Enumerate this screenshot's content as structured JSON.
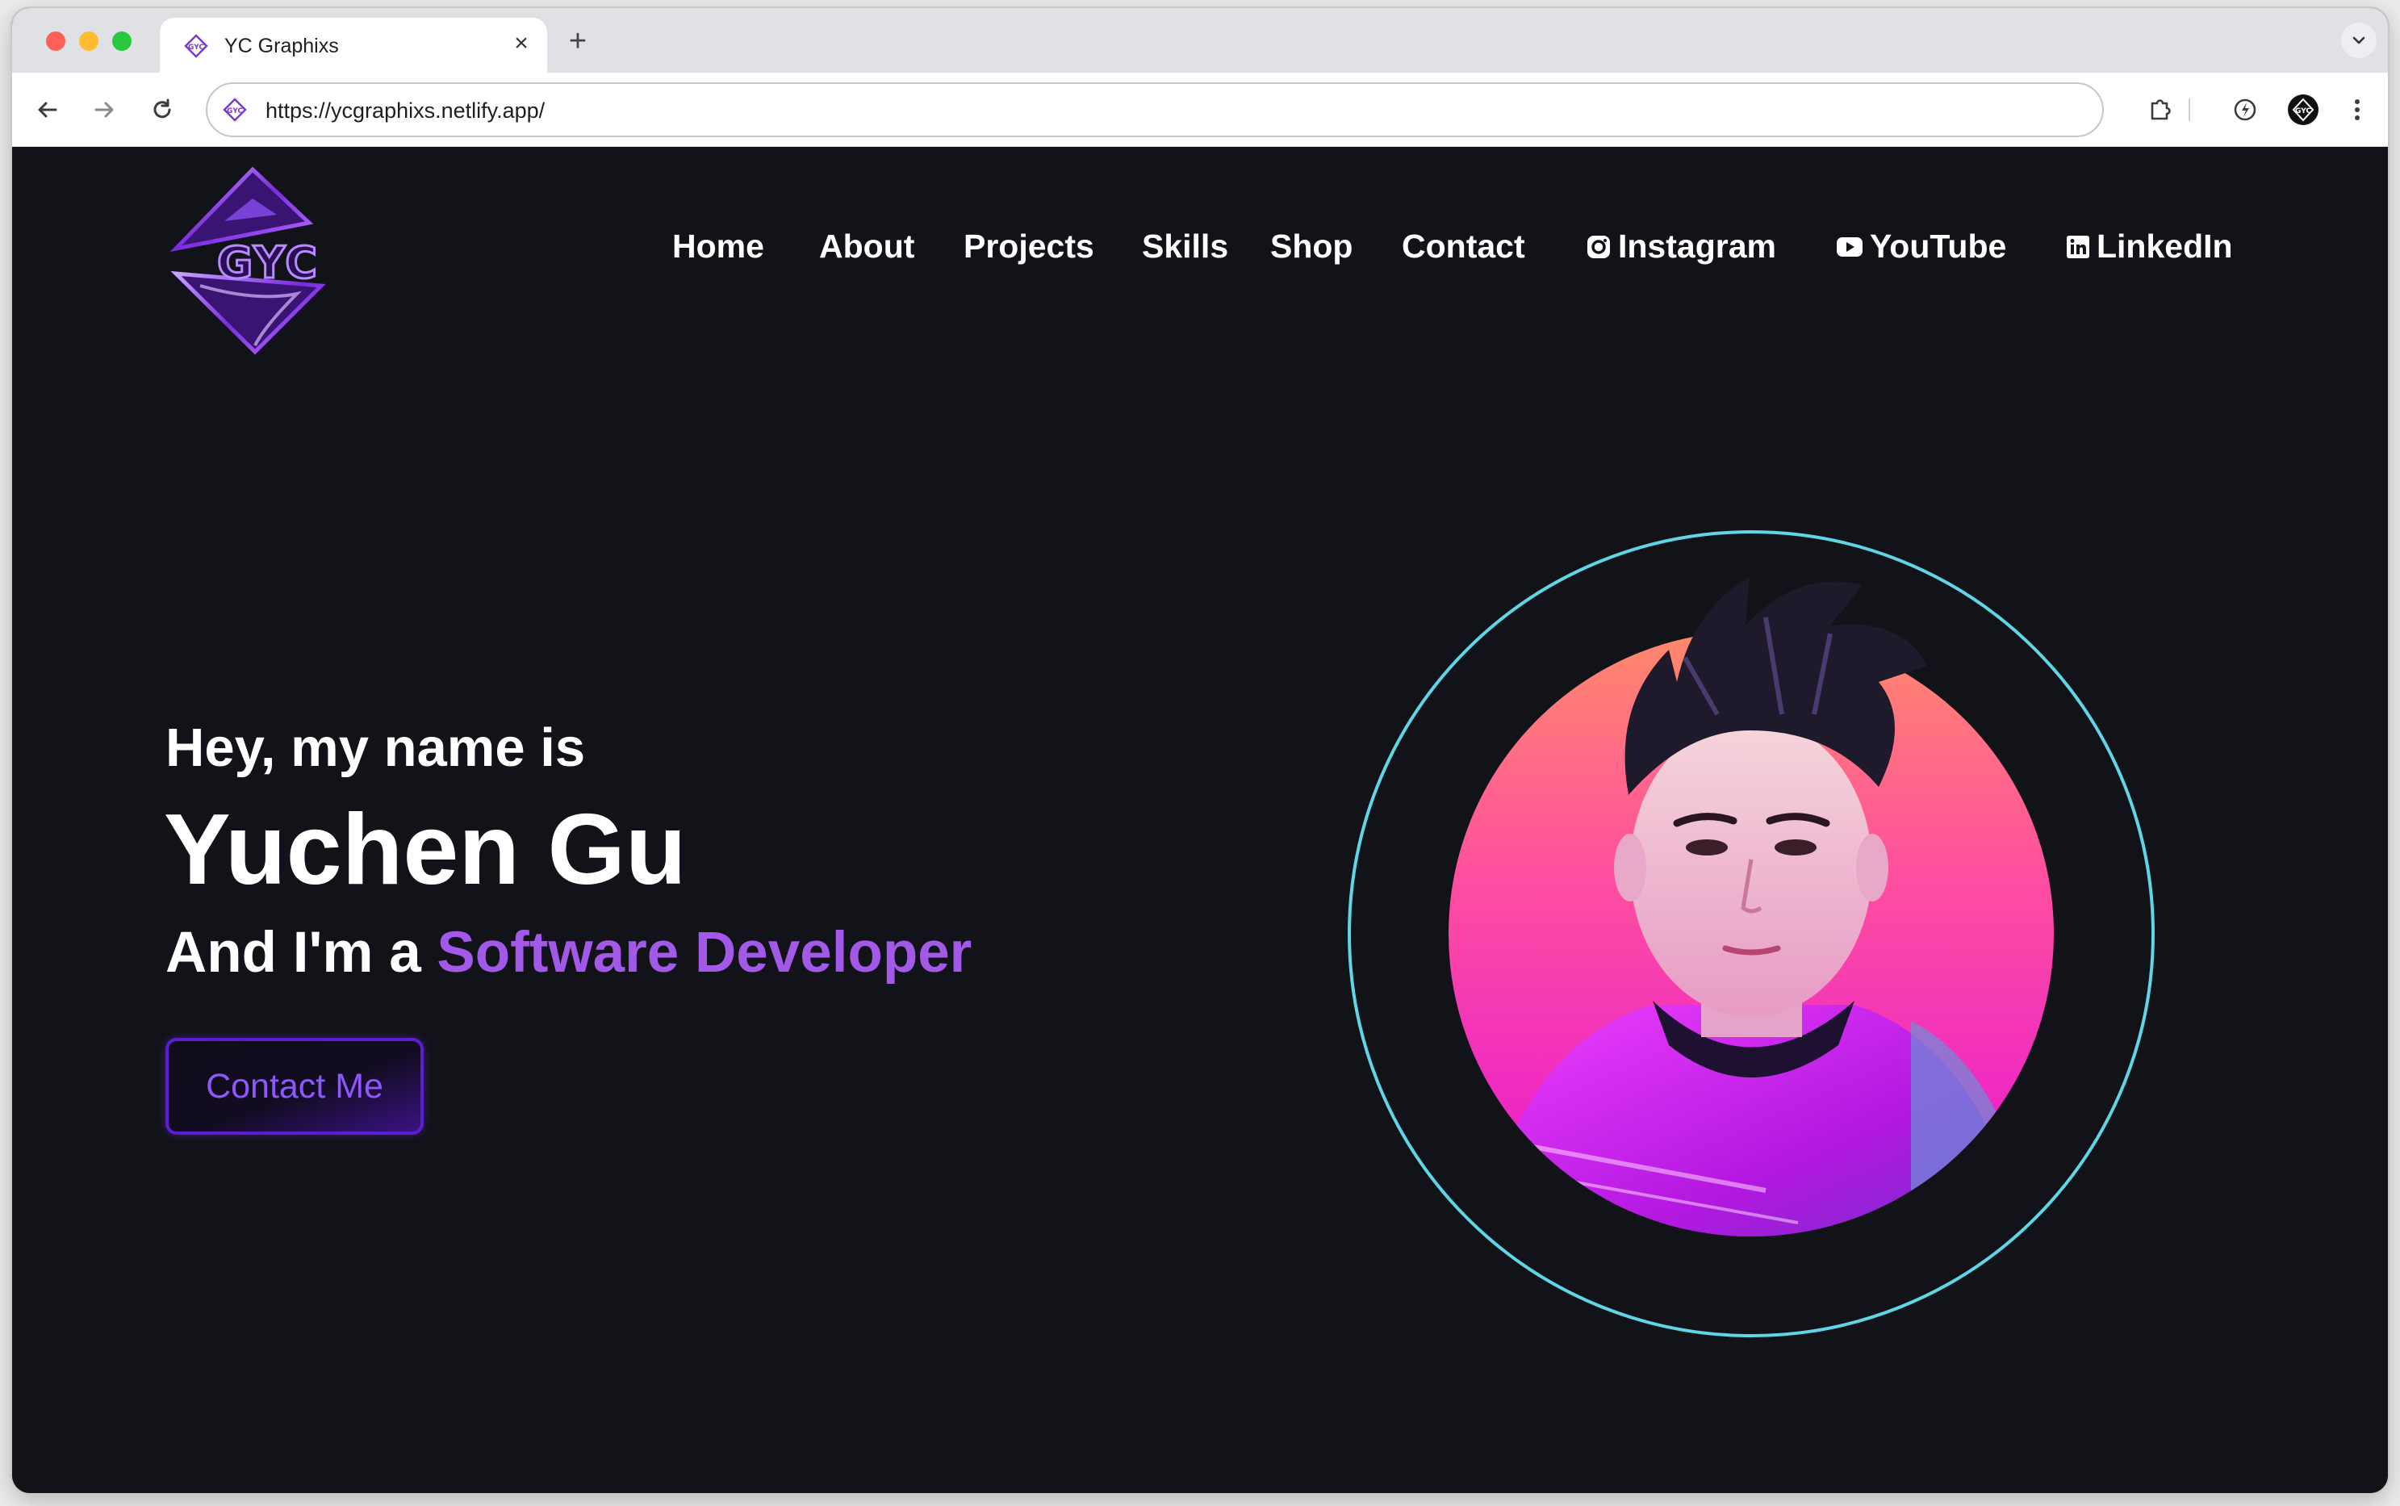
{
  "browser": {
    "tab_title": "YC Graphixs",
    "tab_close_icon": "×",
    "new_tab_icon": "+",
    "url": "https://ycgraphixs.netlify.app/"
  },
  "site": {
    "logo_text": "GYC",
    "nav": [
      {
        "label": "Home"
      },
      {
        "label": "About"
      },
      {
        "label": "Projects"
      },
      {
        "label": "Skills"
      },
      {
        "label": "Shop"
      },
      {
        "label": "Contact"
      },
      {
        "label": "Instagram",
        "icon": "instagram-icon"
      },
      {
        "label": "YouTube",
        "icon": "youtube-icon"
      },
      {
        "label": "LinkedIn",
        "icon": "linkedin-icon"
      }
    ],
    "hero": {
      "intro": "Hey, my name is",
      "name": "Yuchen Gu",
      "role_prefix": "And I'm a ",
      "role": "Software Developer",
      "cta": "Contact Me"
    },
    "colors": {
      "background": "#121318",
      "accent": "#a259e8",
      "button_border": "#5b1fd1",
      "ring_glow": "#4fd8e8"
    }
  }
}
